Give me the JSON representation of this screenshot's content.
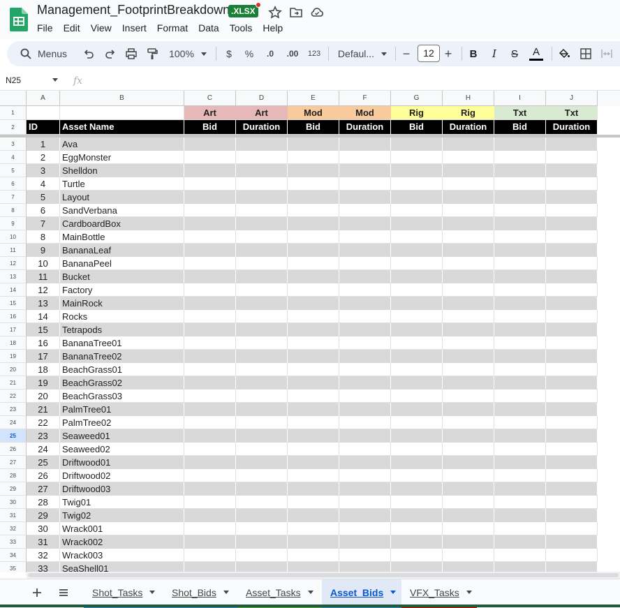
{
  "app": {
    "title": "Management_FootprintBreakdown",
    "badge": ".XLSX"
  },
  "menu": [
    "File",
    "Edit",
    "View",
    "Insert",
    "Format",
    "Data",
    "Tools",
    "Help"
  ],
  "toolbar": {
    "search_label": "Menus",
    "zoom": "100%",
    "currency": "$",
    "percent": "%",
    "dec_decrease": ".0",
    "dec_increase": ".00",
    "number_format": "123",
    "font": "Defaul...",
    "font_size": "12",
    "minus": "−",
    "plus": "+",
    "bold": "B",
    "italic": "I",
    "strike": "S",
    "text_color": "A"
  },
  "formula_bar": {
    "cell_ref": "N25",
    "fx": "fx"
  },
  "columns": [
    "A",
    "B",
    "C",
    "D",
    "E",
    "F",
    "G",
    "H",
    "I",
    "J"
  ],
  "header_row1": [
    {
      "text": "Art",
      "color": "#e6b8b7"
    },
    {
      "text": "Art",
      "color": "#e6b8b7"
    },
    {
      "text": "Mod",
      "color": "#f9cb9c"
    },
    {
      "text": "Mod",
      "color": "#f9cb9c"
    },
    {
      "text": "Rig",
      "color": "#ffff99"
    },
    {
      "text": "Rig",
      "color": "#ffff99"
    },
    {
      "text": "Txt",
      "color": "#d9ead3"
    },
    {
      "text": "Txt",
      "color": "#d9ead3"
    }
  ],
  "header_row2": [
    "ID",
    "Asset Name",
    "Bid",
    "Duration",
    "Bid",
    "Duration",
    "Bid",
    "Duration",
    "Bid",
    "Duration"
  ],
  "row_numbers": [
    "1",
    "2",
    "3",
    "4",
    "5",
    "6",
    "7",
    "8",
    "9",
    "10",
    "11",
    "12",
    "13",
    "14",
    "15",
    "16",
    "17",
    "18",
    "19",
    "20",
    "21",
    "22",
    "23",
    "24",
    "25",
    "26",
    "27",
    "28",
    "29",
    "30",
    "31",
    "32",
    "33",
    "34",
    "35"
  ],
  "selected_row": "25",
  "assets": [
    {
      "id": "1",
      "name": "Ava"
    },
    {
      "id": "2",
      "name": "EggMonster"
    },
    {
      "id": "3",
      "name": "Shelldon"
    },
    {
      "id": "4",
      "name": "Turtle"
    },
    {
      "id": "5",
      "name": "Layout"
    },
    {
      "id": "6",
      "name": "SandVerbana"
    },
    {
      "id": "7",
      "name": "CardboardBox"
    },
    {
      "id": "8",
      "name": "MainBottle"
    },
    {
      "id": "9",
      "name": "BananaLeaf"
    },
    {
      "id": "10",
      "name": "BananaPeel"
    },
    {
      "id": "11",
      "name": "Bucket"
    },
    {
      "id": "12",
      "name": "Factory"
    },
    {
      "id": "13",
      "name": "MainRock"
    },
    {
      "id": "14",
      "name": "Rocks"
    },
    {
      "id": "15",
      "name": "Tetrapods"
    },
    {
      "id": "16",
      "name": "BananaTree01"
    },
    {
      "id": "17",
      "name": "BananaTree02"
    },
    {
      "id": "18",
      "name": "BeachGrass01"
    },
    {
      "id": "19",
      "name": "BeachGrass02"
    },
    {
      "id": "20",
      "name": "BeachGrass03"
    },
    {
      "id": "21",
      "name": "PalmTree01"
    },
    {
      "id": "22",
      "name": "PalmTree02"
    },
    {
      "id": "23",
      "name": "Seaweed01"
    },
    {
      "id": "24",
      "name": "Seaweed02"
    },
    {
      "id": "25",
      "name": "Driftwood01"
    },
    {
      "id": "26",
      "name": "Driftwood02"
    },
    {
      "id": "27",
      "name": "Driftwood03"
    },
    {
      "id": "28",
      "name": "Twig01"
    },
    {
      "id": "29",
      "name": "Twig02"
    },
    {
      "id": "30",
      "name": "Wrack001"
    },
    {
      "id": "31",
      "name": "Wrack002"
    },
    {
      "id": "32",
      "name": "Wrack003"
    },
    {
      "id": "33",
      "name": "SeaShell01"
    }
  ],
  "sheets": [
    {
      "name": "Shot_Tasks",
      "color": "#4a86c5",
      "active": false
    },
    {
      "name": "Shot_Bids",
      "color": "#4a86c5",
      "active": false
    },
    {
      "name": "Asset_Tasks",
      "color": "#6aa84f",
      "active": false
    },
    {
      "name": "Asset_Bids",
      "color": "#4a86c5",
      "active": true
    },
    {
      "name": "VFX_Tasks",
      "color": "#cc0000",
      "active": false
    }
  ],
  "colors": {
    "stripe": "#d9d9d9",
    "header_black": "#000000",
    "brand_green": "#188038"
  }
}
